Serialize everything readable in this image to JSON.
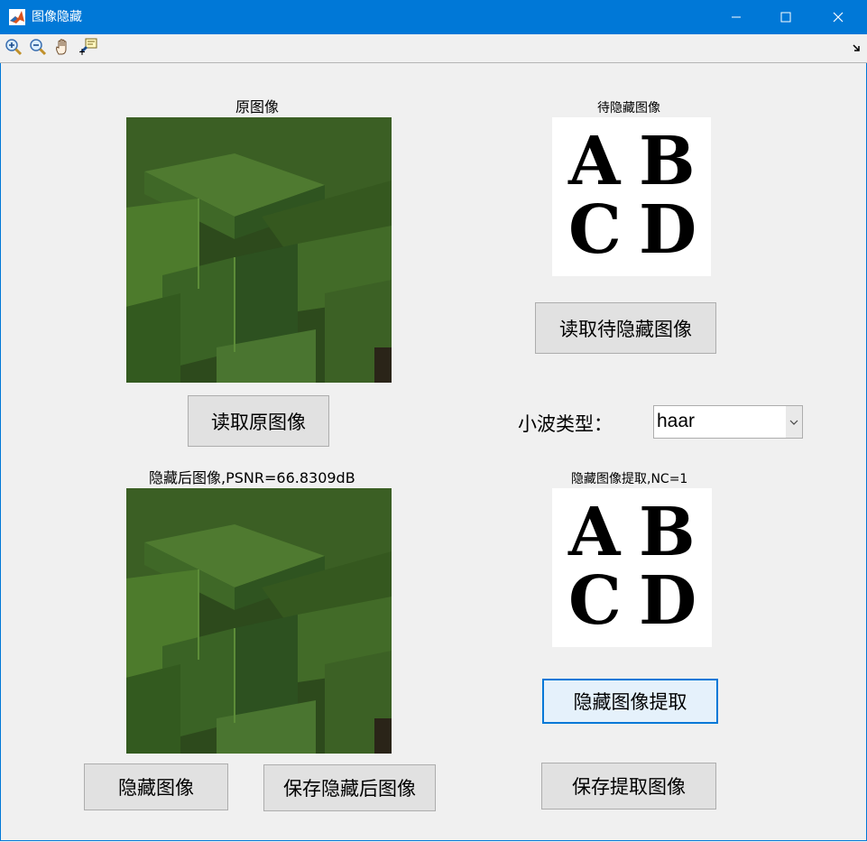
{
  "window": {
    "title": "图像隐藏",
    "icons": {
      "app": "matlab-icon",
      "minimize": "minimize-icon",
      "maximize": "maximize-icon",
      "close": "close-icon"
    }
  },
  "toolbar": {
    "tools": [
      "zoom-in-icon",
      "zoom-out-icon",
      "pan-hand-icon",
      "data-cursor-icon"
    ],
    "dock": "dock-arrow-icon"
  },
  "panels": {
    "original": {
      "title": "原图像"
    },
    "secret": {
      "title": "待隐藏图像",
      "letters": [
        "A",
        "B",
        "C",
        "D"
      ]
    },
    "stego": {
      "title": "隐藏后图像,PSNR=66.8309dB"
    },
    "extracted": {
      "title": "隐藏图像提取,NC=1",
      "letters": [
        "A",
        "B",
        "C",
        "D"
      ]
    }
  },
  "buttons": {
    "read_secret": "读取待隐藏图像",
    "read_original": "读取原图像",
    "hide": "隐藏图像",
    "save_stego": "保存隐藏后图像",
    "extract": "隐藏图像提取",
    "save_extracted": "保存提取图像"
  },
  "wavelet": {
    "label": "小波类型：",
    "selected": "haar"
  },
  "colors": {
    "titlebar": "#0078d7",
    "background": "#f0f0f0",
    "button": "#e1e1e1",
    "focus": "#0078d7"
  }
}
